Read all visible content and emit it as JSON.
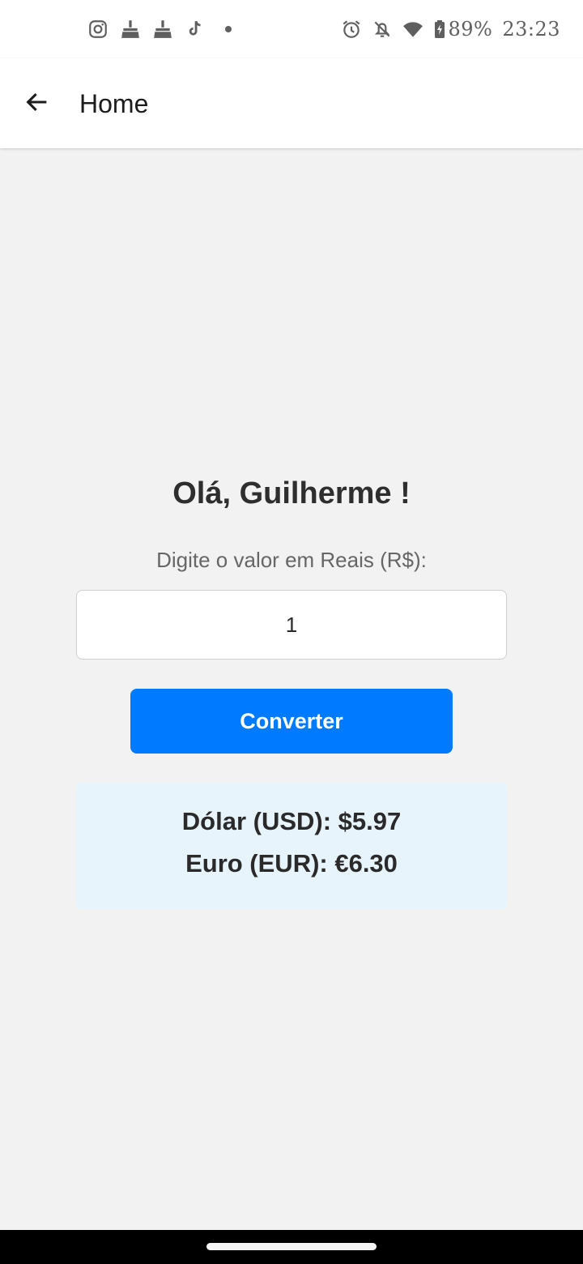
{
  "status_bar": {
    "battery": "89%",
    "time": "23:23",
    "left_icons": [
      "instagram-icon",
      "cleaner-broom-icon",
      "cleaner-broom-icon",
      "tiktok-icon",
      "more-notifications-dot-icon"
    ],
    "right_icons": [
      "alarm-icon",
      "notifications-off-icon",
      "wifi-icon",
      "battery-charging-icon"
    ]
  },
  "app_bar": {
    "back_icon": "arrow-left-icon",
    "title": "Home"
  },
  "main": {
    "greeting": "Olá, Guilherme !",
    "input_label": "Digite o valor em Reais (R$):",
    "amount_value": "1",
    "convert_label": "Converter"
  },
  "results": {
    "usd_line": "Dólar (USD): $5.97",
    "eur_line": "Euro (EUR): €6.30"
  },
  "colors": {
    "primary": "#007bff",
    "background": "#f2f2f2",
    "result_background": "#e8f4fc",
    "text": "#2a2a2a"
  }
}
